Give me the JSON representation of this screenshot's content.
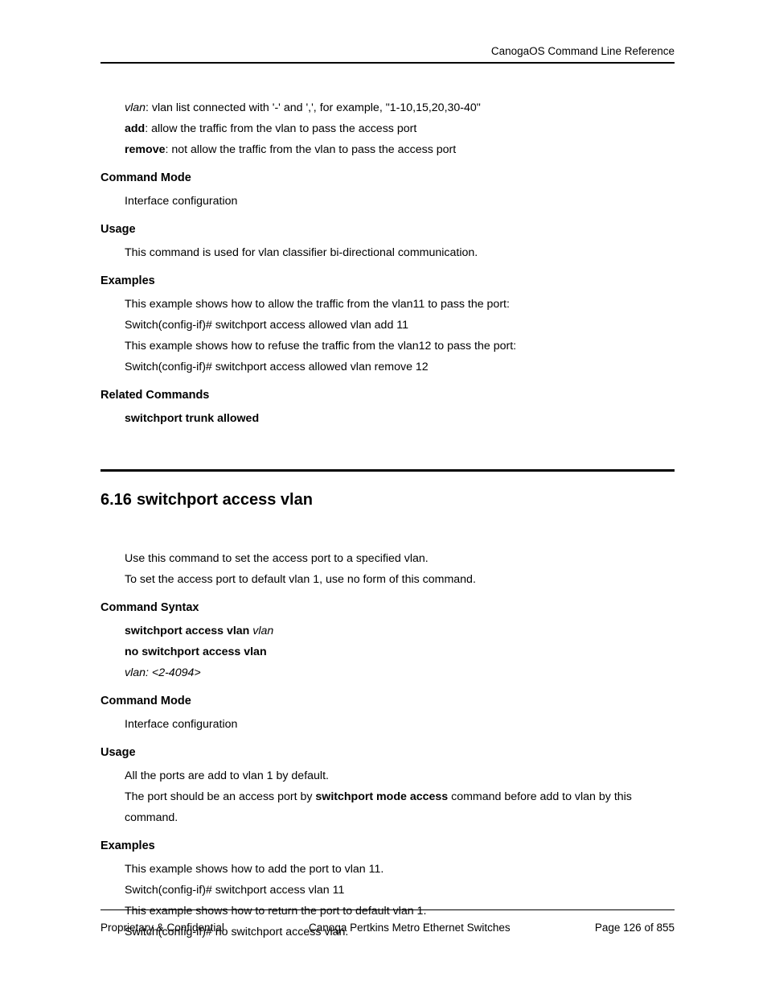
{
  "header": {
    "title": "CanogaOS Command Line Reference"
  },
  "section1": {
    "defs": {
      "vlan_term": "vlan",
      "vlan_text": ": vlan list connected with '-' and ',', for example, \"1-10,15,20,30-40\"",
      "add_term": "add",
      "add_text": ": allow the traffic from the vlan to pass the access port",
      "remove_term": "remove",
      "remove_text": ": not allow the traffic from the vlan to pass the access port"
    },
    "cmd_mode_heading": "Command Mode",
    "cmd_mode_text": "Interface configuration",
    "usage_heading": "Usage",
    "usage_text": "This command is used for vlan classifier bi-directional communication.",
    "examples_heading": "Examples",
    "examples": {
      "l1": "This example shows how to allow the traffic from the vlan11 to pass the port:",
      "l2": "Switch(config-if)# switchport access allowed vlan add 11",
      "l3": "This example shows how to refuse the traffic from the vlan12 to pass the port:",
      "l4": "Switch(config-if)# switchport access allowed vlan remove 12"
    },
    "related_heading": "Related Commands",
    "related_text": "switchport trunk allowed"
  },
  "section2": {
    "number": "6.16",
    "title": "switchport access vlan",
    "intro1": "Use this command to set the access port to a specified vlan.",
    "intro2": "To set the access port to default vlan 1, use no form of this command.",
    "syntax_heading": "Command Syntax",
    "syntax": {
      "l1_bold": "switchport access vlan ",
      "l1_ital": "vlan",
      "l2": "no switchport access vlan",
      "l3": "vlan: <2-4094>"
    },
    "cmd_mode_heading": "Command Mode",
    "cmd_mode_text": "Interface configuration",
    "usage_heading": "Usage",
    "usage": {
      "l1": "All the ports are add to vlan 1 by default.",
      "l2a": "The port should be an access port by ",
      "l2b": "switchport mode access",
      "l2c": " command before add to vlan by this command."
    },
    "examples_heading": "Examples",
    "examples": {
      "l1": "This example shows how to add the port to vlan 11.",
      "l2": "Switch(config-if)# switchport access vlan 11",
      "l3": "This example shows how to return the port to default vlan 1.",
      "l4": "Switch(config-if)# no switchport access vlan."
    }
  },
  "footer": {
    "left": "Proprietary & Confidential",
    "center": "Canoga Pertkins Metro Ethernet Switches",
    "right": "Page 126 of 855"
  }
}
